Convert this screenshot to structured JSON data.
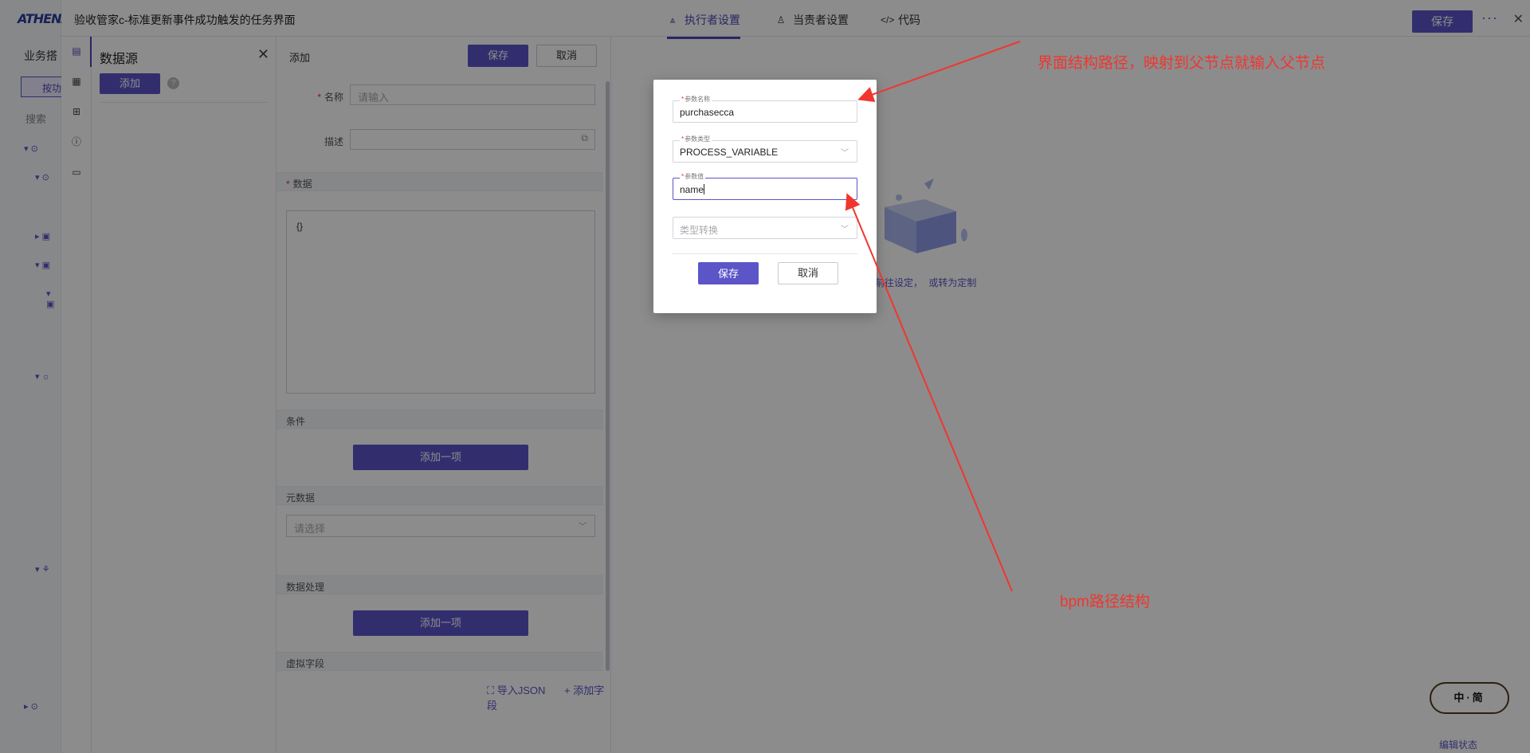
{
  "app": {
    "logo_text": "ATHENA",
    "biz_label": "业务搭",
    "side_btn": "按功",
    "side_search": "搜索",
    "doc_title": "验收管家c-标准更新事件成功触发的任务界面",
    "tabs": [
      {
        "label": "执行者设置",
        "icon": "executor-icon",
        "active": true
      },
      {
        "label": "当责者设置",
        "icon": "person-icon",
        "active": false
      },
      {
        "label": "代码",
        "icon": "code-icon",
        "active": false
      }
    ],
    "save_label": "保存",
    "more_label": "···",
    "close_label": "✕"
  },
  "datasource": {
    "title": "数据源",
    "add_label": "添加",
    "help_label": "?"
  },
  "form": {
    "header": "添加",
    "save_label": "保存",
    "cancel_label": "取消",
    "name_label": "名称",
    "name_placeholder": "请输入",
    "desc_label": "描述",
    "data_label": "数据",
    "data_value": "{}",
    "condition_label": "条件",
    "add_item_label": "添加一项",
    "metadata_label": "元数据",
    "select_placeholder": "请选择",
    "processing_label": "数据处理",
    "virtual_label": "虚拟字段",
    "import_json": "导入JSON",
    "add_field": "+ 添加字段"
  },
  "empty_state": {
    "text_a": "，前往设定，",
    "text_b": "或转为定制"
  },
  "modal": {
    "param_name_label": "参数名称",
    "param_name_value": "purchasecca",
    "param_type_label": "参数类型",
    "param_type_value": "PROCESS_VARIABLE",
    "param_value_label": "参数值",
    "param_value_value": "name",
    "type_convert_placeholder": "类型转换",
    "save_label": "保存",
    "cancel_label": "取消"
  },
  "annotations": {
    "top": "界面结构路径，映射到父节点就输入父节点",
    "bottom": "bpm路径结构"
  },
  "widget": {
    "face": "中·简",
    "status": "编辑状态"
  },
  "colors": {
    "accent": "#5b55c8",
    "annotation": "#f0362f",
    "required": "#e0302a"
  }
}
